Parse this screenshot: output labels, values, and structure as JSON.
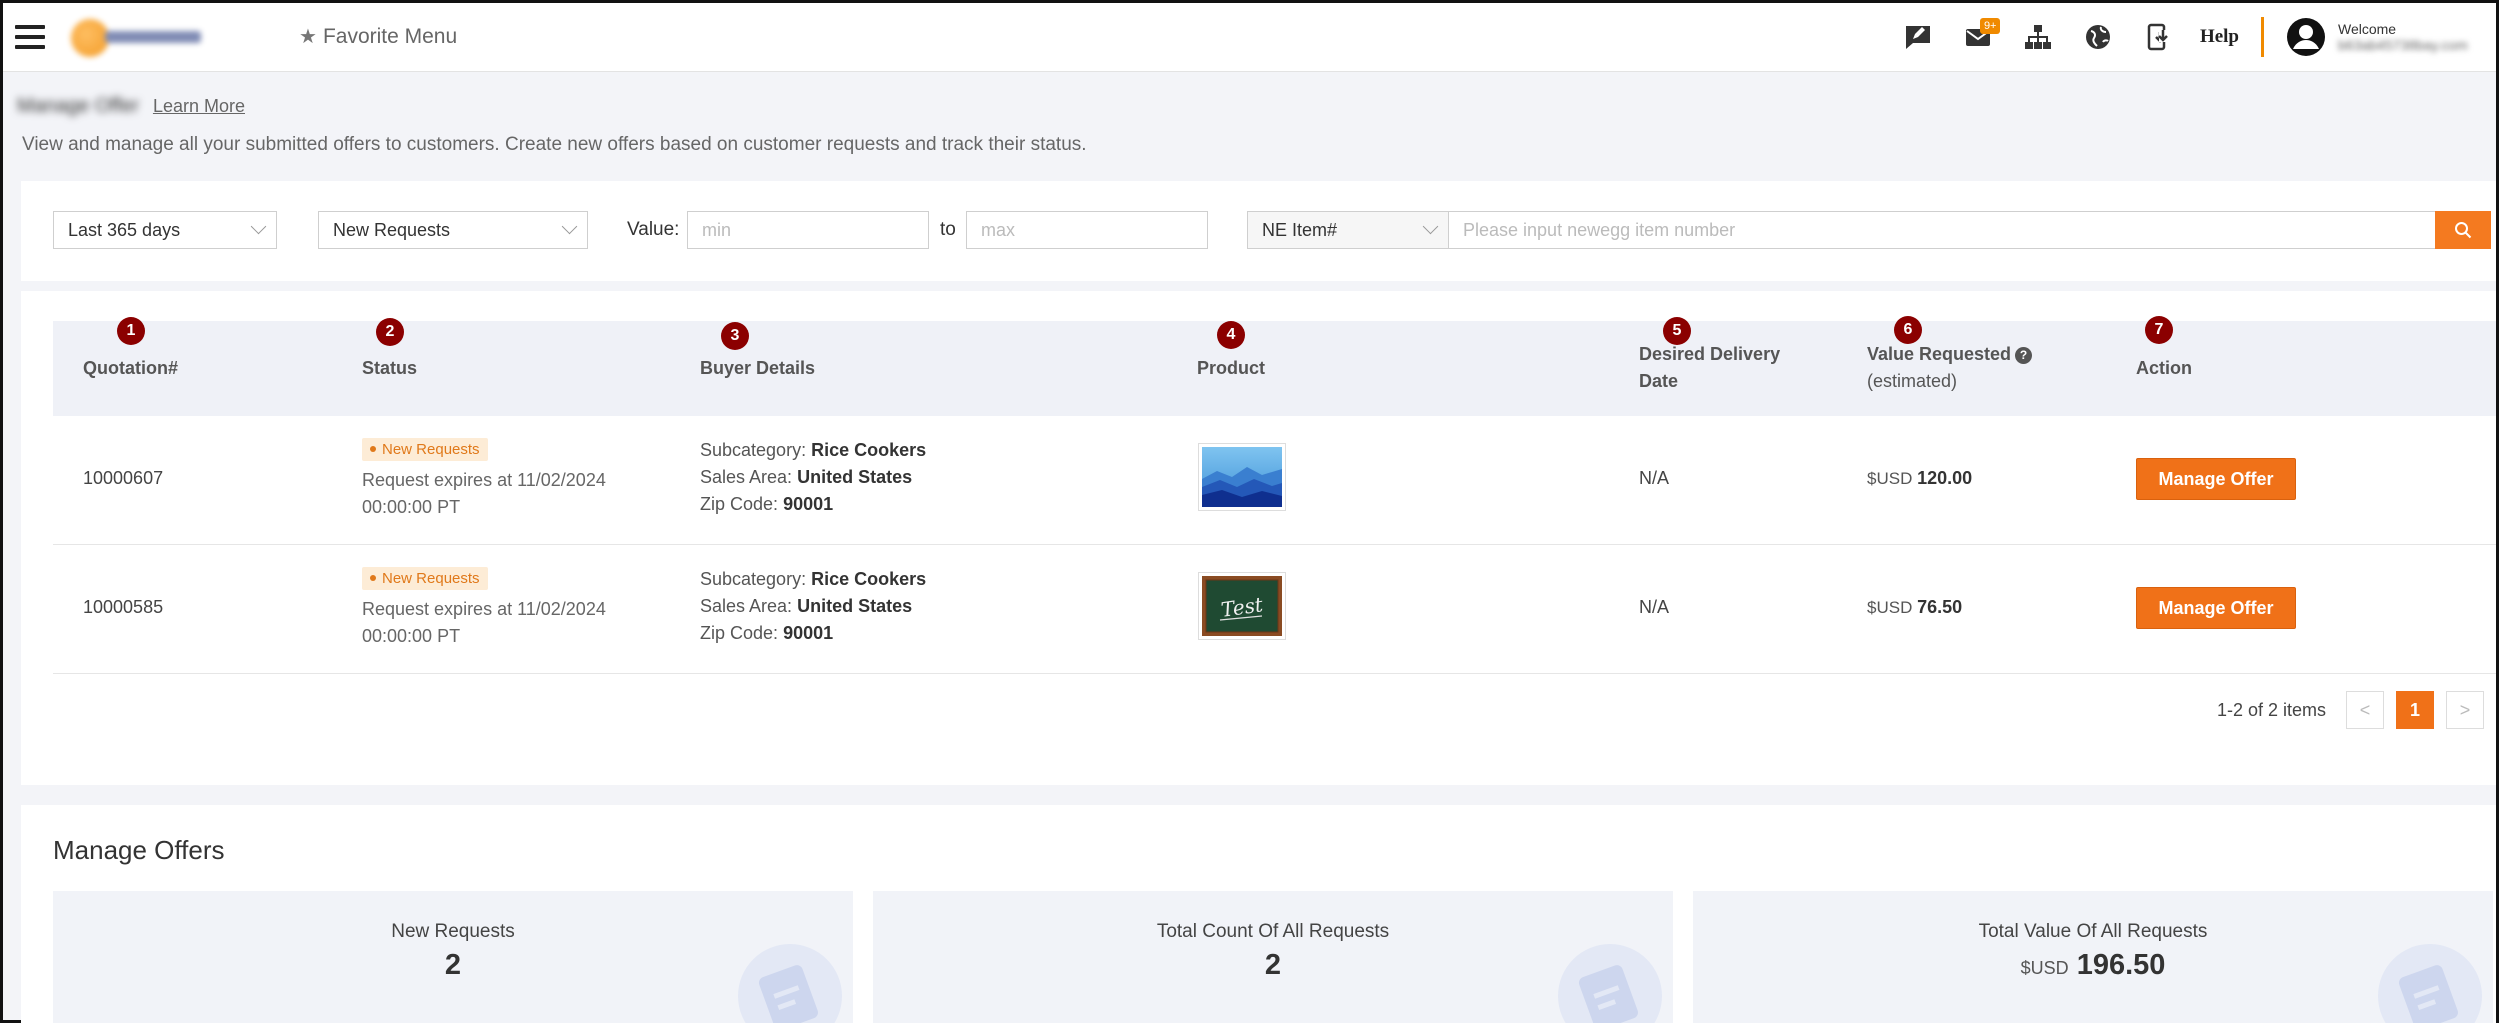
{
  "topbar": {
    "favorite_label": "Favorite Menu",
    "mail_badge": "9+",
    "help_label": "Help",
    "welcome_label": "Welcome",
    "user_name": "b63ab45738bay.com"
  },
  "page": {
    "title": "Manage Offer",
    "learn_more": "Learn More",
    "description": "View and manage all your submitted offers to customers. Create new offers based on customer requests and track their status."
  },
  "filters": {
    "date_range": "Last 365 days",
    "status": "New Requests",
    "value_label": "Value:",
    "min_placeholder": "min",
    "to_label": "to",
    "max_placeholder": "max",
    "search_type": "NE Item#",
    "search_placeholder": "Please input newegg item number"
  },
  "table": {
    "headers": {
      "quotation": "Quotation#",
      "status": "Status",
      "buyer": "Buyer Details",
      "product": "Product",
      "delivery_line1": "Desired Delivery",
      "delivery_line2": "Date",
      "value_line1": "Value Requested",
      "value_line2": "(estimated)",
      "action": "Action"
    },
    "markers": [
      "1",
      "2",
      "3",
      "4",
      "5",
      "6",
      "7"
    ],
    "rows": [
      {
        "quotation": "10000607",
        "status_badge": "New Requests",
        "expiry_line1": "Request expires at 11/02/2024",
        "expiry_line2": "00:00:00 PT",
        "subcategory_label": "Subcategory:",
        "subcategory": "Rice Cookers",
        "sales_area_label": "Sales Area:",
        "sales_area": "United States",
        "zip_label": "Zip Code:",
        "zip": "90001",
        "product_image": "blue-mountains-image",
        "delivery": "N/A",
        "currency": "$USD",
        "value": "120.00",
        "action": "Manage Offer"
      },
      {
        "quotation": "10000585",
        "status_badge": "New Requests",
        "expiry_line1": "Request expires at 11/02/2024",
        "expiry_line2": "00:00:00 PT",
        "subcategory_label": "Subcategory:",
        "subcategory": "Rice Cookers",
        "sales_area_label": "Sales Area:",
        "sales_area": "United States",
        "zip_label": "Zip Code:",
        "zip": "90001",
        "product_image": "chalkboard-test-image",
        "product_image_text": "Test",
        "delivery": "N/A",
        "currency": "$USD",
        "value": "76.50",
        "action": "Manage Offer"
      }
    ],
    "pagination": {
      "info": "1-2 of 2 items",
      "prev": "<",
      "current": "1",
      "next": ">"
    }
  },
  "manage_offers": {
    "title": "Manage Offers",
    "cards": [
      {
        "label": "New Requests",
        "value": "2"
      },
      {
        "label": "Total Count Of All Requests",
        "value": "2"
      },
      {
        "label": "Total Value Of All Requests",
        "unit": "$USD",
        "value": "196.50"
      }
    ]
  },
  "colors": {
    "accent": "#f07118",
    "marker": "#8b0000",
    "badge_bg": "#fdecd6"
  }
}
